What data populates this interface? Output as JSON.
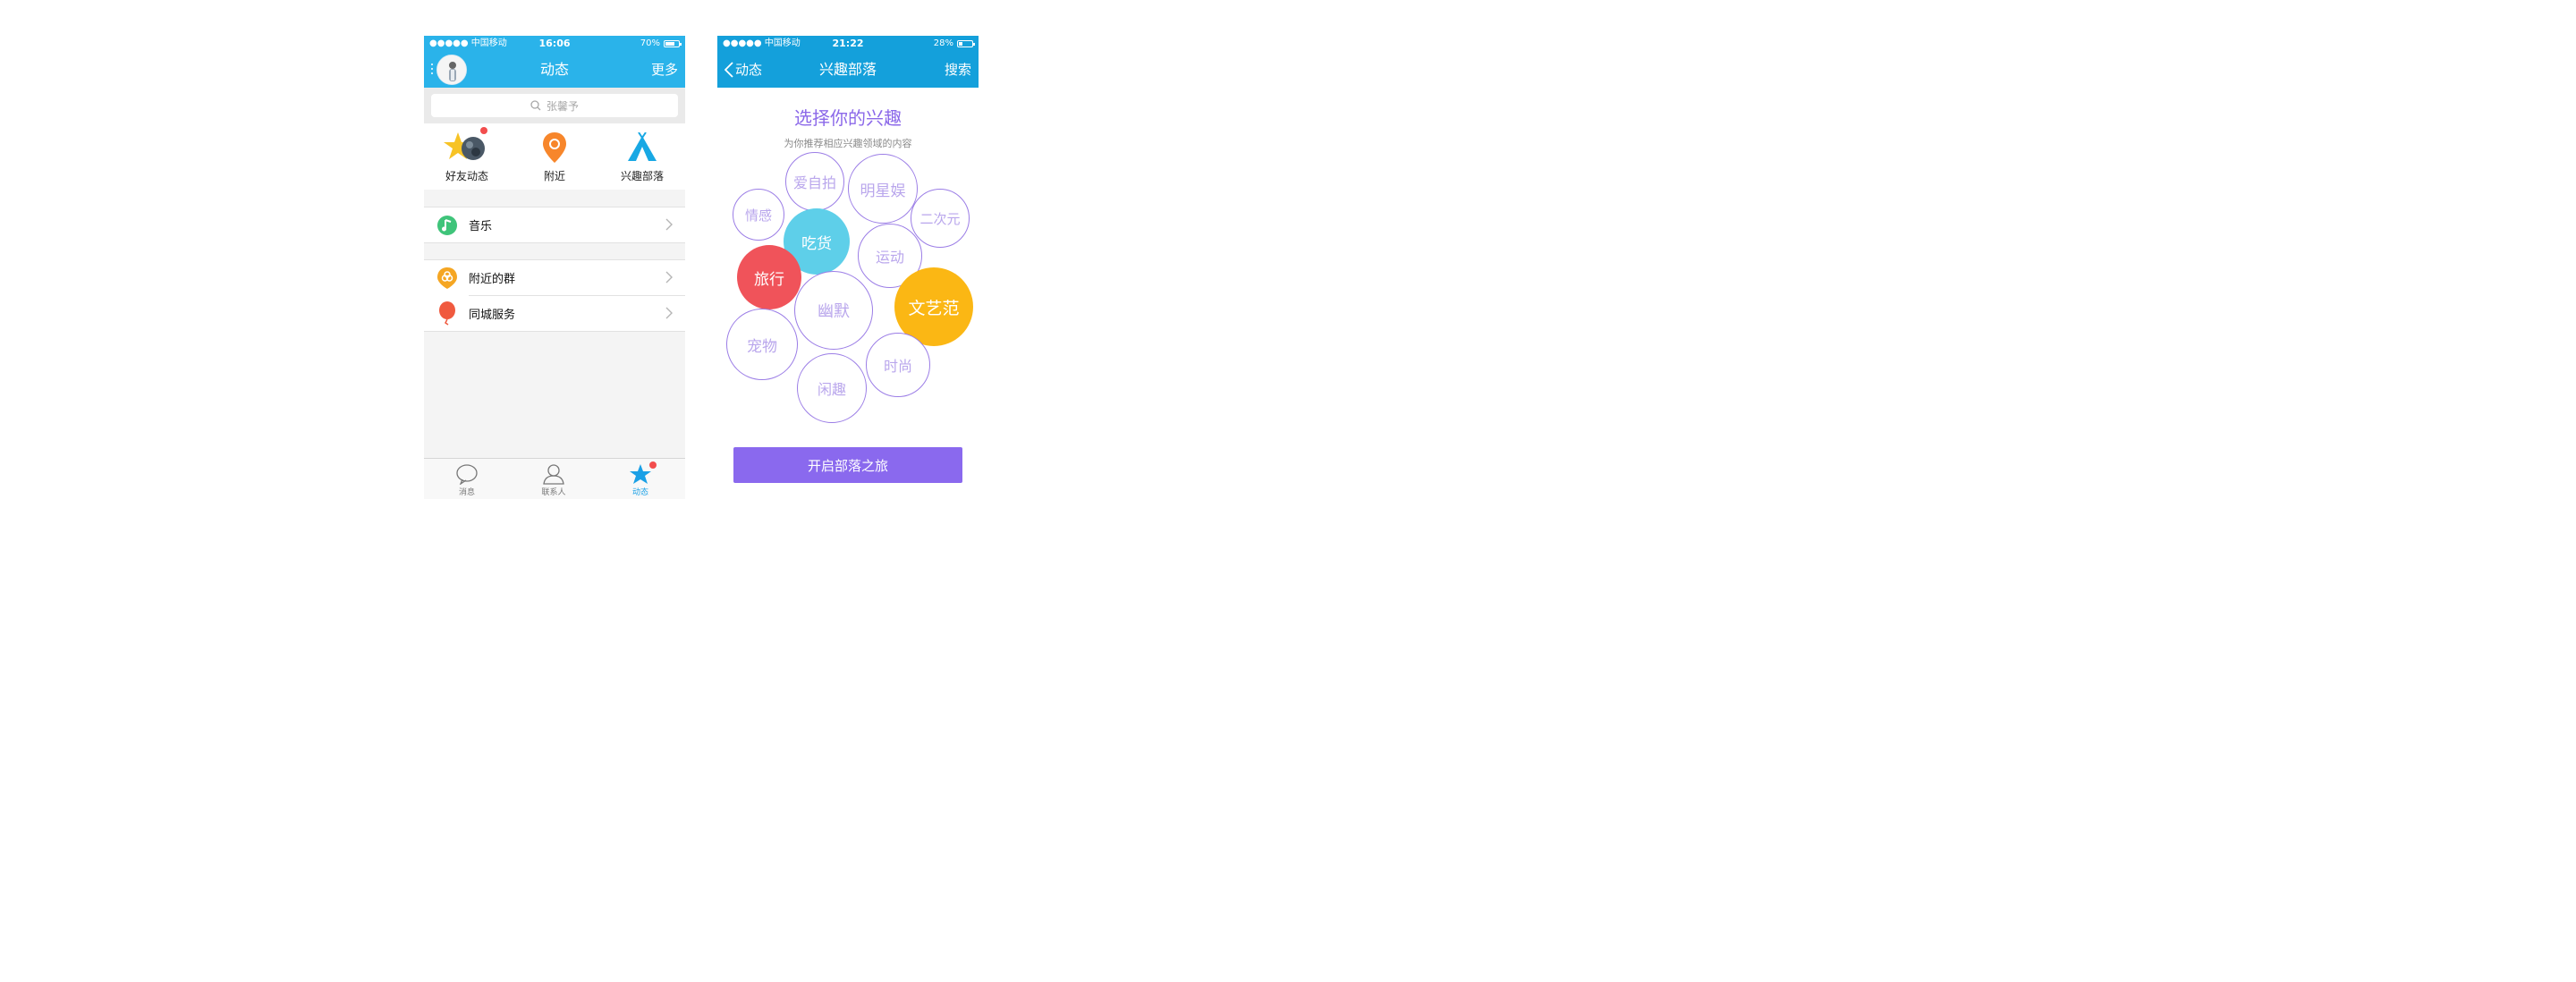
{
  "left": {
    "status": {
      "carrier": "●●●●● 中国移动",
      "time": "16:06",
      "battery": "70%",
      "battery_level": 0.7
    },
    "nav": {
      "title": "动态",
      "right": "更多"
    },
    "search": {
      "placeholder": "张馨予"
    },
    "quick": [
      {
        "label": "好友动态",
        "icon": "star-avatar-icon"
      },
      {
        "label": "附近",
        "icon": "location-pin-icon"
      },
      {
        "label": "兴趣部落",
        "icon": "tent-icon"
      }
    ],
    "group1": [
      {
        "label": "音乐",
        "icon": "music-note-icon"
      }
    ],
    "group2": [
      {
        "label": "附近的群",
        "icon": "group-location-icon"
      },
      {
        "label": "同城服务",
        "icon": "balloon-icon"
      }
    ],
    "tabs": [
      {
        "label": "消息",
        "icon": "chat-bubble-icon"
      },
      {
        "label": "联系人",
        "icon": "contact-person-icon"
      },
      {
        "label": "动态",
        "icon": "star-icon",
        "active": true
      }
    ],
    "colors": {
      "header": "#2ab3ea",
      "active": "#1aa0e6",
      "badge": "#f24d4d"
    }
  },
  "right": {
    "status": {
      "carrier": "●●●●● 中国移动",
      "time": "21:22",
      "battery": "28%",
      "battery_level": 0.28
    },
    "nav": {
      "back": "动态",
      "title": "兴趣部落",
      "right": "搜索"
    },
    "title": "选择你的兴趣",
    "subtitle": "为你推荐相应兴趣领域的内容",
    "bubbles": [
      {
        "label": "爱自拍"
      },
      {
        "label": "明星娱"
      },
      {
        "label": "情感"
      },
      {
        "label": "二次元"
      },
      {
        "label": "吃货",
        "selected": true,
        "color": "#5ecfe9"
      },
      {
        "label": "运动"
      },
      {
        "label": "旅行",
        "selected": true,
        "color": "#f0535a"
      },
      {
        "label": "文艺范",
        "selected": true,
        "color": "#fbb714"
      },
      {
        "label": "幽默"
      },
      {
        "label": "宠物"
      },
      {
        "label": "时尚"
      },
      {
        "label": "闲趣"
      }
    ],
    "button": "开启部落之旅",
    "colors": {
      "header": "#14a0db",
      "accent": "#8a69ee"
    }
  }
}
